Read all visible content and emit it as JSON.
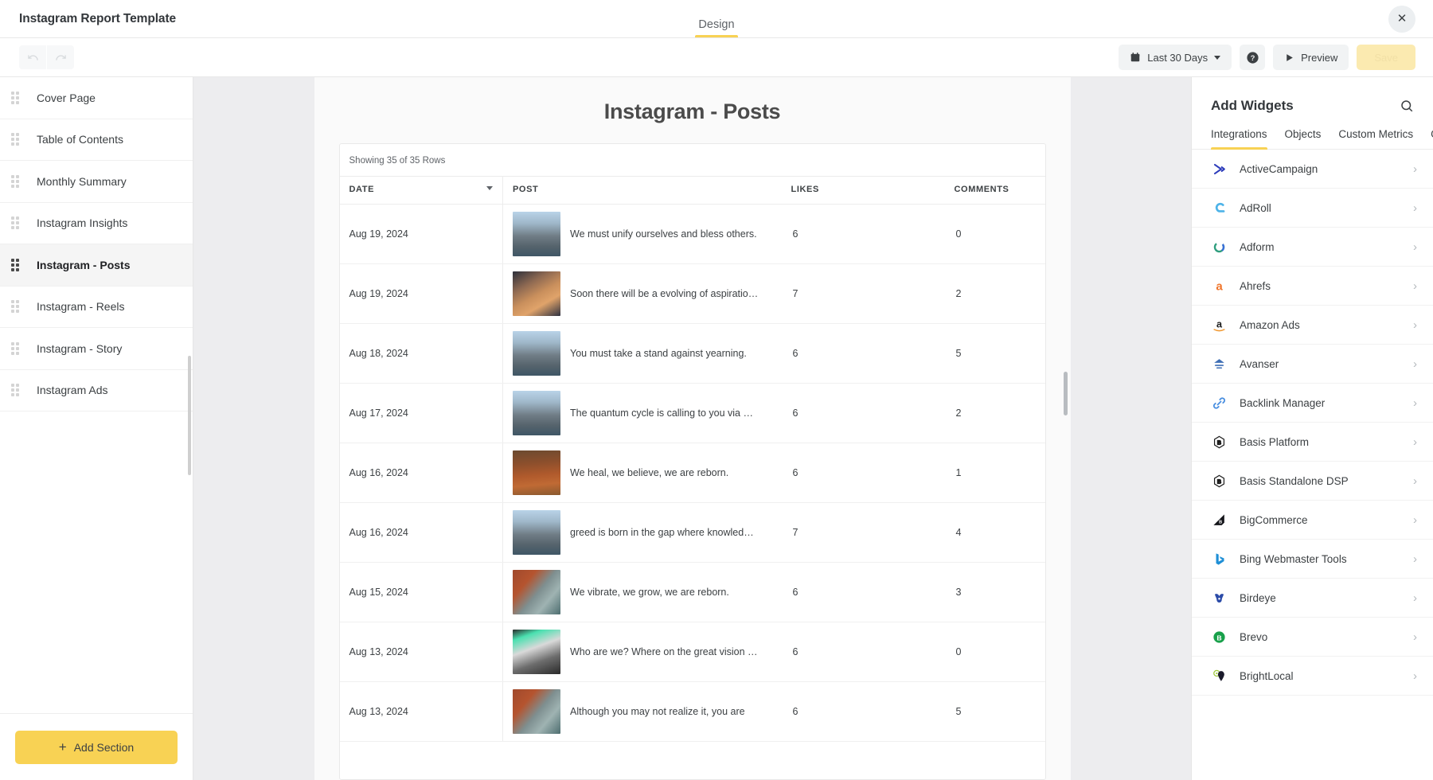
{
  "titlebar": {
    "doc_title": "Instagram Report Template",
    "tabs": [
      {
        "label": "Design",
        "active": true
      }
    ],
    "close_label": "✕"
  },
  "toolbar": {
    "undo_label": "↺",
    "redo_label": "↻",
    "date_range": "Last 30 Days",
    "help_label": "?",
    "preview_label": "Preview",
    "save_label": "Save"
  },
  "sidebar": {
    "items": [
      {
        "label": "Cover Page",
        "active": false
      },
      {
        "label": "Table of Contents",
        "active": false
      },
      {
        "label": "Monthly Summary",
        "active": false
      },
      {
        "label": "Instagram Insights",
        "active": false
      },
      {
        "label": "Instagram - Posts",
        "active": true
      },
      {
        "label": "Instagram - Reels",
        "active": false
      },
      {
        "label": "Instagram - Story",
        "active": false
      },
      {
        "label": "Instagram Ads",
        "active": false
      }
    ],
    "add_section_label": "Add Section",
    "add_section_plus": "+"
  },
  "canvas": {
    "page_title": "Instagram - Posts",
    "widget": {
      "rows_count_text": "Showing 35 of 35 Rows",
      "columns": [
        "DATE",
        "POST",
        "LIKES",
        "COMMENTS"
      ],
      "sorted_column": "DATE",
      "rows": [
        {
          "date": "Aug 19, 2024",
          "post": "We must unify ourselves and bless others.",
          "likes": "6",
          "comments": "0",
          "thumb": "city"
        },
        {
          "date": "Aug 19, 2024",
          "post": "Soon there will be a evolving of aspiratio…",
          "likes": "7",
          "comments": "2",
          "thumb": "stadium"
        },
        {
          "date": "Aug 18, 2024",
          "post": "You must take a stand against yearning.",
          "likes": "6",
          "comments": "5",
          "thumb": "city"
        },
        {
          "date": "Aug 17, 2024",
          "post": "The quantum cycle is calling to you via …",
          "likes": "6",
          "comments": "2",
          "thumb": "city"
        },
        {
          "date": "Aug 16, 2024",
          "post": "We heal, we believe, we are reborn.",
          "likes": "6",
          "comments": "1",
          "thumb": "autumn"
        },
        {
          "date": "Aug 16, 2024",
          "post": "greed is born in the gap where knowled…",
          "likes": "7",
          "comments": "4",
          "thumb": "city"
        },
        {
          "date": "Aug 15, 2024",
          "post": "We vibrate, we grow, we are reborn.",
          "likes": "6",
          "comments": "3",
          "thumb": "coast"
        },
        {
          "date": "Aug 13, 2024",
          "post": "Who are we? Where on the great vision …",
          "likes": "6",
          "comments": "0",
          "thumb": "market"
        },
        {
          "date": "Aug 13, 2024",
          "post": "Although you may not realize it, you are",
          "likes": "6",
          "comments": "5",
          "thumb": "coast"
        }
      ]
    }
  },
  "rightpanel": {
    "title": "Add Widgets",
    "search_icon_name": "search-icon",
    "tabs": [
      {
        "label": "Integrations",
        "active": true
      },
      {
        "label": "Objects",
        "active": false
      },
      {
        "label": "Custom Metrics",
        "active": false
      },
      {
        "label": "Goals",
        "active": false
      }
    ],
    "chevron": "›",
    "integrations": [
      {
        "name": "ActiveCampaign",
        "icon": "activecampaign",
        "color": "#2e3dbb"
      },
      {
        "name": "AdRoll",
        "icon": "adroll",
        "color": "#4db3e8"
      },
      {
        "name": "Adform",
        "icon": "adform",
        "color": "#2f9e7e"
      },
      {
        "name": "Ahrefs",
        "icon": "ahrefs",
        "color": "#f0762c"
      },
      {
        "name": "Amazon Ads",
        "icon": "amazon-ads",
        "color": "#1b1b1b"
      },
      {
        "name": "Avanser",
        "icon": "avanser",
        "color": "#3f6fb5"
      },
      {
        "name": "Backlink Manager",
        "icon": "backlink-manager",
        "color": "#4a8fe0"
      },
      {
        "name": "Basis Platform",
        "icon": "basis-platform",
        "color": "#1b1b1b"
      },
      {
        "name": "Basis Standalone DSP",
        "icon": "basis-standalone-dsp",
        "color": "#1b1b1b"
      },
      {
        "name": "BigCommerce",
        "icon": "bigcommerce",
        "color": "#14151a"
      },
      {
        "name": "Bing Webmaster Tools",
        "icon": "bing-webmaster-tools",
        "color": "#1e8fd6"
      },
      {
        "name": "Birdeye",
        "icon": "birdeye",
        "color": "#2b4ba8"
      },
      {
        "name": "Brevo",
        "icon": "brevo",
        "color": "#18a04a"
      },
      {
        "name": "BrightLocal",
        "icon": "brightlocal",
        "color": "#1b1b2b"
      }
    ]
  },
  "colors": {
    "accent_yellow": "#f8d254",
    "canvas_bg": "#ededef",
    "page_bg": "#fafafa"
  }
}
